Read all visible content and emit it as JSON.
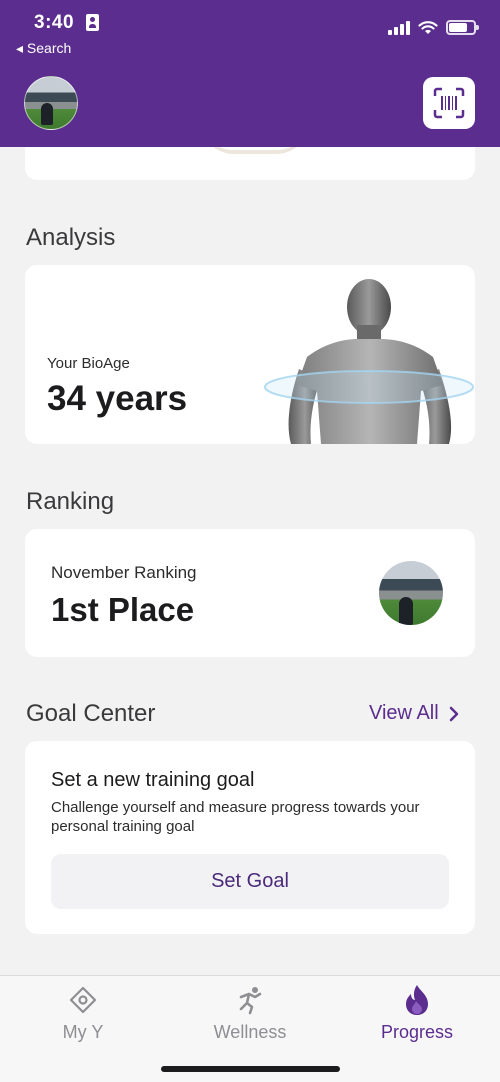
{
  "status_bar": {
    "time": "3:40",
    "back_label": "◂ Search"
  },
  "analysis": {
    "section_title": "Analysis",
    "label": "Your BioAge",
    "value": "34 years"
  },
  "ranking": {
    "section_title": "Ranking",
    "label": "November Ranking",
    "value": "1st Place"
  },
  "goal_center": {
    "section_title": "Goal Center",
    "view_all_label": "View All",
    "card_title": "Set a new training goal",
    "card_description": "Challenge yourself and measure progress towards your personal training goal",
    "button_label": "Set Goal"
  },
  "tabbar": {
    "tabs": [
      {
        "label": "My Y",
        "icon": "location-diamond-icon",
        "active": false
      },
      {
        "label": "Wellness",
        "icon": "runner-icon",
        "active": false
      },
      {
        "label": "Progress",
        "icon": "flame-icon",
        "active": true
      }
    ]
  },
  "colors": {
    "brand": "#5b2d8e",
    "background": "#f2f2f3",
    "card": "#ffffff"
  }
}
